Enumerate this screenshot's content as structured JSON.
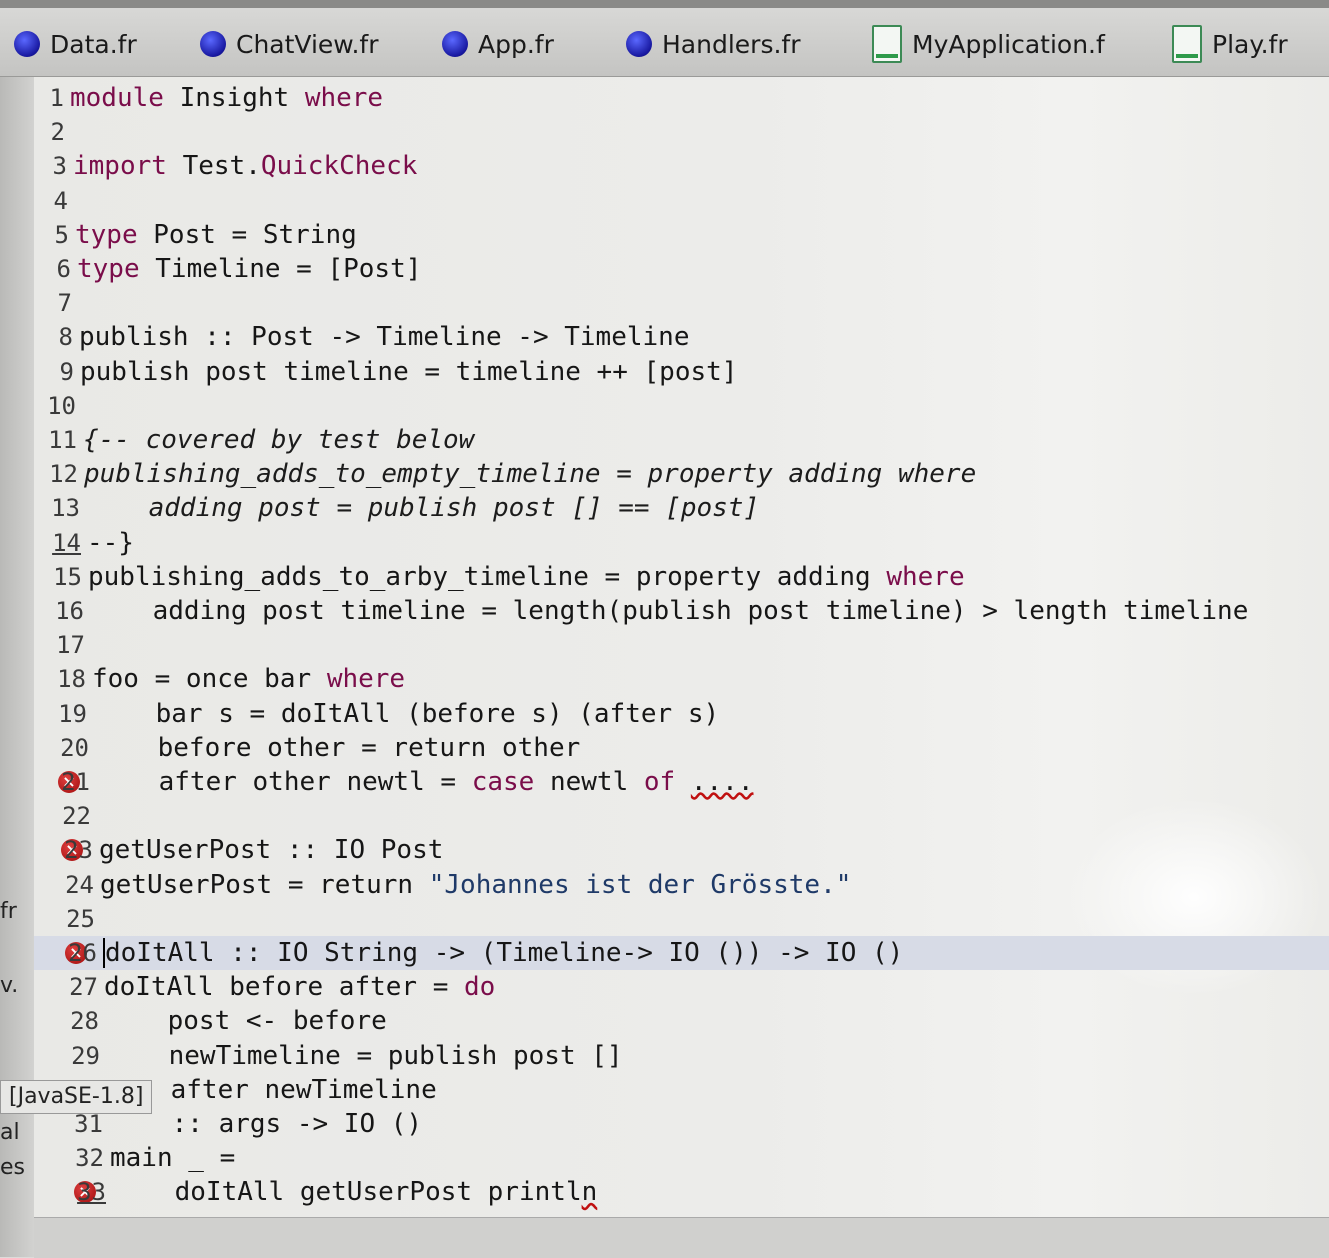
{
  "tabs": [
    {
      "label": "Data.fr",
      "icon": "frege-dot-icon"
    },
    {
      "label": "ChatView.fr",
      "icon": "frege-dot-icon"
    },
    {
      "label": "App.fr",
      "icon": "frege-dot-icon"
    },
    {
      "label": "Handlers.fr",
      "icon": "frege-dot-icon"
    },
    {
      "label": "MyApplication.f",
      "icon": "java-file-icon"
    },
    {
      "label": "Play.fr",
      "icon": "java-file-icon"
    }
  ],
  "side_labels": {
    "fr": "fr",
    "v": "v.",
    "al": "al",
    "es": "es"
  },
  "tooltip": "[JavaSE-1.8]",
  "editor": {
    "current_line": 26,
    "error_lines": [
      21,
      23,
      26,
      33
    ],
    "lines": [
      {
        "n": "1",
        "parts": [
          [
            "kw",
            "module"
          ],
          [
            "t",
            " Insight "
          ],
          [
            "kw",
            "where"
          ]
        ]
      },
      {
        "n": "2",
        "parts": []
      },
      {
        "n": "3",
        "parts": [
          [
            "kw",
            "import"
          ],
          [
            "t",
            " Test."
          ],
          [
            "mod",
            "QuickCheck"
          ]
        ]
      },
      {
        "n": "4",
        "parts": []
      },
      {
        "n": "5",
        "parts": [
          [
            "kw",
            "type"
          ],
          [
            "t",
            " Post = String"
          ]
        ]
      },
      {
        "n": "6",
        "parts": [
          [
            "kw",
            "type"
          ],
          [
            "t",
            " Timeline = [Post]"
          ]
        ]
      },
      {
        "n": "7",
        "parts": []
      },
      {
        "n": "8",
        "parts": [
          [
            "t",
            "publish :: Post -> Timeline -> Timeline"
          ]
        ]
      },
      {
        "n": "9",
        "parts": [
          [
            "t",
            "publish post timeline = timeline ++ [post]"
          ]
        ]
      },
      {
        "n": "10",
        "parts": []
      },
      {
        "n": "11",
        "parts": [
          [
            "cmt",
            "{-- covered by test below"
          ]
        ]
      },
      {
        "n": "12",
        "parts": [
          [
            "cmt",
            "publishing_adds_to_empty_timeline = property adding where"
          ]
        ]
      },
      {
        "n": "13",
        "parts": [
          [
            "cmt",
            "    adding post = publish post [] == [post]"
          ]
        ]
      },
      {
        "n": "14",
        "parts": [
          [
            "t",
            "--}"
          ]
        ]
      },
      {
        "n": "15",
        "parts": [
          [
            "t",
            "publishing_adds_to_arby_timeline = property adding "
          ],
          [
            "kw",
            "where"
          ]
        ]
      },
      {
        "n": "16",
        "parts": [
          [
            "t",
            "    adding post timeline = length(publish post timeline) > length timeline"
          ]
        ]
      },
      {
        "n": "17",
        "parts": []
      },
      {
        "n": "18",
        "parts": [
          [
            "t",
            "foo = once bar "
          ],
          [
            "kw",
            "where"
          ]
        ]
      },
      {
        "n": "19",
        "parts": [
          [
            "t",
            "    bar s = doItAll (before s) (after s)"
          ]
        ]
      },
      {
        "n": "20",
        "parts": [
          [
            "t",
            "    before other = return other"
          ]
        ]
      },
      {
        "n": "21",
        "parts": [
          [
            "t",
            "    after other newtl = "
          ],
          [
            "kw",
            "case"
          ],
          [
            "t",
            " newtl "
          ],
          [
            "kw",
            "of"
          ],
          [
            "t",
            " "
          ],
          [
            "wavy",
            "...."
          ]
        ]
      },
      {
        "n": "22",
        "parts": []
      },
      {
        "n": "23",
        "parts": [
          [
            "t",
            "getUserPost :: IO Post"
          ]
        ]
      },
      {
        "n": "24",
        "parts": [
          [
            "t",
            "getUserPost = return "
          ],
          [
            "str",
            "\"Johannes ist der Grösste.\""
          ]
        ]
      },
      {
        "n": "25",
        "parts": []
      },
      {
        "n": "26",
        "parts": [
          [
            "caret",
            ""
          ],
          [
            "t",
            "doItAll :: IO String -> (Timeline-> IO ()) -> IO ()"
          ]
        ]
      },
      {
        "n": "27",
        "parts": [
          [
            "t",
            "doItAll before after = "
          ],
          [
            "kw",
            "do"
          ]
        ]
      },
      {
        "n": "28",
        "parts": [
          [
            "t",
            "    post <- before"
          ]
        ]
      },
      {
        "n": "29",
        "parts": [
          [
            "t",
            "    newTimeline = publish post []"
          ]
        ]
      },
      {
        "n": "30",
        "parts": [
          [
            "t",
            "    after newTimeline"
          ]
        ]
      },
      {
        "n": "31",
        "parts": [
          [
            "t",
            "    :: args -> IO ()"
          ]
        ]
      },
      {
        "n": "32",
        "parts": [
          [
            "t",
            "main _ ="
          ]
        ]
      },
      {
        "n": "33",
        "parts": [
          [
            "t",
            "    doItAll getUserPost printl"
          ],
          [
            "wavy",
            "n"
          ]
        ]
      }
    ]
  }
}
